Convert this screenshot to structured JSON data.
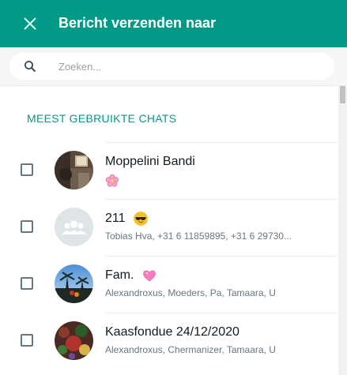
{
  "header": {
    "title": "Bericht verzenden naar"
  },
  "search": {
    "placeholder": "Zoeken..."
  },
  "section": {
    "title": "MEEST GEBRUIKTE CHATS"
  },
  "chats": [
    {
      "name": "Moppelini Bandi",
      "subtitle": "",
      "subtitle_icon": "cherry-blossom-icon",
      "name_icon": "",
      "checked": false
    },
    {
      "name": "211",
      "subtitle": "Tobias Hva, +31 6 11859895, +31 6 29730...",
      "name_icon": "sunglasses-face-icon",
      "checked": false
    },
    {
      "name": "Fam.",
      "subtitle": "Alexandroxus, Moeders, Pa, Tamaara, U",
      "name_icon": "pink-heart-icon",
      "checked": false
    },
    {
      "name": "Kaasfondue 24/12/2020",
      "subtitle": "Alexandroxus, Chermanizer, Tamaara, U",
      "name_icon": "",
      "checked": false
    }
  ],
  "colors": {
    "header": "#009a86",
    "accent": "#009a86"
  }
}
